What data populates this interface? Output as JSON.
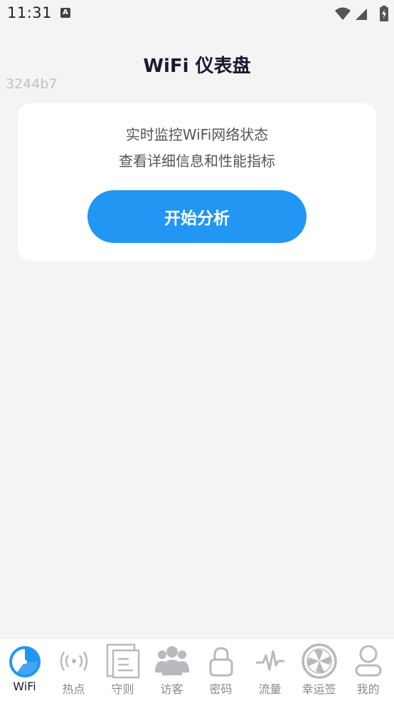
{
  "status_bar": {
    "time": "11:31",
    "notification": "A"
  },
  "header": {
    "title": "WiFi 仪表盘",
    "build_id": "3244b7"
  },
  "card": {
    "line1": "实时监控WiFi网络状态",
    "line2": "查看详细信息和性能指标",
    "button_label": "开始分析"
  },
  "nav": {
    "items": [
      {
        "label": "WiFi",
        "icon": "pie-chart-icon",
        "active": true
      },
      {
        "label": "热点",
        "icon": "broadcast-icon"
      },
      {
        "label": "守则",
        "icon": "document-icon"
      },
      {
        "label": "访客",
        "icon": "people-icon"
      },
      {
        "label": "密码",
        "icon": "lock-icon"
      },
      {
        "label": "流量",
        "icon": "waveform-icon"
      },
      {
        "label": "幸运签",
        "icon": "fan-icon"
      },
      {
        "label": "我的",
        "icon": "user-icon"
      }
    ]
  },
  "colors": {
    "accent": "#2196f3",
    "background": "#f4f4f5",
    "card": "#ffffff",
    "inactive_icon": "#b9b9bd"
  }
}
